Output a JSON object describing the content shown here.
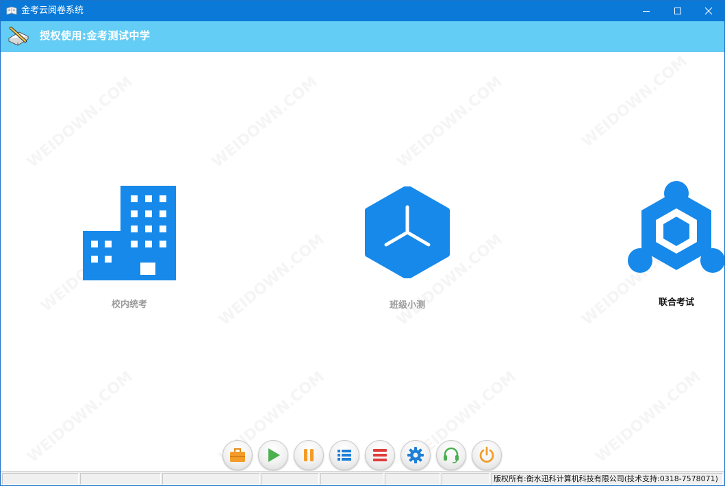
{
  "window": {
    "title": "金考云阅卷系统",
    "app_icon": "book-icon",
    "controls": [
      "minimize-icon",
      "maximize-icon",
      "close-icon"
    ]
  },
  "header": {
    "logo_icon": "pen-book-icon",
    "license_text": "授权使用:金考测试中学"
  },
  "modes": [
    {
      "label": "校内统考",
      "icon": "building-icon",
      "active": false
    },
    {
      "label": "班级小测",
      "icon": "hexagon-node-icon",
      "active": false
    },
    {
      "label": "联合考试",
      "icon": "network-hexagon-icon",
      "active": true
    }
  ],
  "toolbar": {
    "buttons": [
      {
        "icon": "briefcase-icon",
        "color": "#f39c29"
      },
      {
        "icon": "play-icon",
        "color": "#4caf50"
      },
      {
        "icon": "pause-icon",
        "color": "#f39c29"
      },
      {
        "icon": "list-icon",
        "color": "#1e7fd6"
      },
      {
        "icon": "menu-icon",
        "color": "#e03b3b"
      },
      {
        "icon": "gear-icon",
        "color": "#1e7fd6"
      },
      {
        "icon": "headset-icon",
        "color": "#4caf50"
      },
      {
        "icon": "power-icon",
        "color": "#f39c29"
      }
    ]
  },
  "statusbar": {
    "copyright": "版权所有:衡水迅科计算机科技有限公司(技术支持:0318-7578071)"
  },
  "watermark": "WEIDOWN.COM",
  "colors": {
    "titlebar": "#0a79d8",
    "header": "#64cdf5",
    "icon_blue": "#1689ea",
    "label_inactive": "#9a9a9a",
    "label_active": "#111111"
  }
}
